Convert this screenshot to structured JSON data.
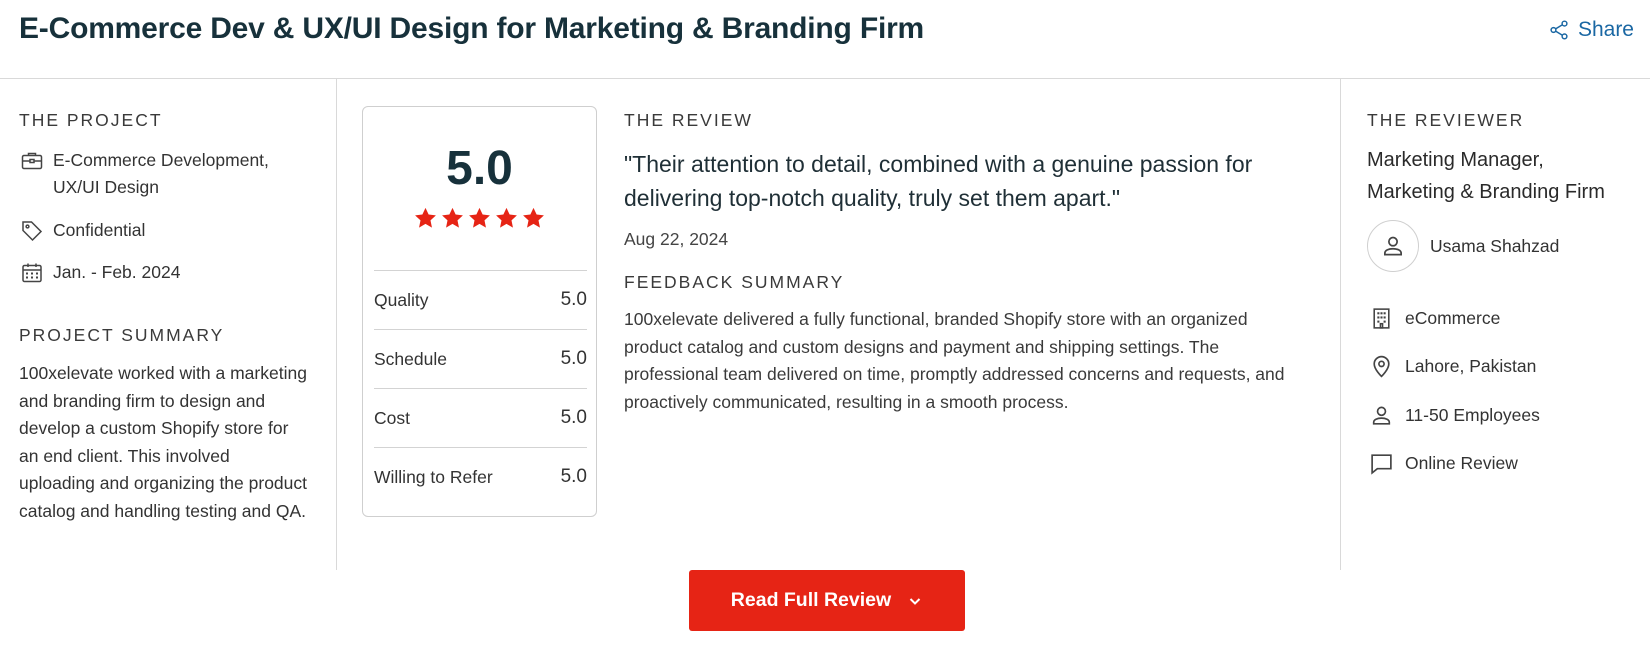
{
  "header": {
    "title": "E-Commerce Dev & UX/UI Design for Marketing & Branding Firm",
    "share_label": "Share"
  },
  "project": {
    "section_label": "THE PROJECT",
    "service_line1": "E-Commerce Development,",
    "service_line2": "UX/UI Design",
    "budget": "Confidential",
    "dates": "Jan. - Feb. 2024",
    "summary_label": "PROJECT SUMMARY",
    "summary": "100xelevate worked with a marketing and branding firm to design and develop a custom Shopify store for an end client. This involved uploading and organizing the product catalog and handling testing and QA."
  },
  "rating": {
    "overall": "5.0",
    "stars": 5,
    "rows": [
      {
        "label": "Quality",
        "value": "5.0"
      },
      {
        "label": "Schedule",
        "value": "5.0"
      },
      {
        "label": "Cost",
        "value": "5.0"
      },
      {
        "label": "Willing to Refer",
        "value": "5.0"
      }
    ]
  },
  "review": {
    "section_label": "THE REVIEW",
    "quote": "\"Their attention to detail, combined with a genuine passion for delivering top-notch quality, truly set them apart.\"",
    "date": "Aug 22, 2024",
    "feedback_label": "FEEDBACK SUMMARY",
    "feedback": "100xelevate delivered a fully functional, branded Shopify store with an organized product catalog and custom designs and payment and shipping settings. The professional team delivered on time, promptly addressed concerns and requests, and proactively communicated, resulting in a smooth process."
  },
  "reviewer": {
    "section_label": "THE REVIEWER",
    "title_line1": "Marketing Manager,",
    "title_line2": "Marketing & Branding Firm",
    "name": "Usama Shahzad",
    "industry": "eCommerce",
    "location": "Lahore, Pakistan",
    "size": "11-50 Employees",
    "review_type": "Online Review"
  },
  "actions": {
    "read_full_review": "Read Full Review"
  },
  "colors": {
    "accent_red": "#e62415",
    "link_blue": "#1a67a3",
    "title_dark": "#17313b"
  },
  "icons": [
    "share-icon",
    "briefcase-icon",
    "tag-icon",
    "calendar-icon",
    "star-icon",
    "user-icon",
    "building-icon",
    "location-pin-icon",
    "chat-icon",
    "chevron-down-icon"
  ]
}
